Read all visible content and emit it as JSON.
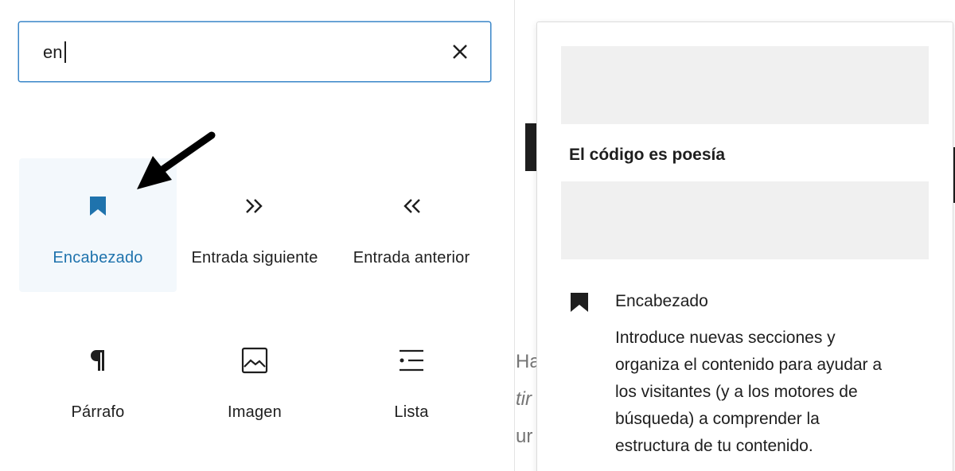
{
  "search": {
    "value": "en",
    "clear_label": "×"
  },
  "blocks": [
    {
      "label": "Encabezado",
      "icon": "bookmark-icon"
    },
    {
      "label": "Entrada siguiente",
      "icon": "double-chevron-right-icon"
    },
    {
      "label": "Entrada anterior",
      "icon": "double-chevron-left-icon"
    },
    {
      "label": "Párrafo",
      "icon": "pilcrow-icon"
    },
    {
      "label": "Imagen",
      "icon": "image-icon"
    },
    {
      "label": "Lista",
      "icon": "list-icon"
    }
  ],
  "background": {
    "line1": "Ha",
    "line2": "tir",
    "line3": "ur"
  },
  "preview": {
    "heading": "El código es poesía",
    "title": "Encabezado",
    "description": "Introduce nuevas secciones y organiza el contenido para ayudar a los visitantes (y a los motores de búsqueda) a comprender la estructura de tu contenido."
  },
  "colors": {
    "accent": "#1f73ad",
    "focus_border": "#3a86c8",
    "selected_bg": "#f3f8fc",
    "placeholder": "#f0f0f0"
  }
}
